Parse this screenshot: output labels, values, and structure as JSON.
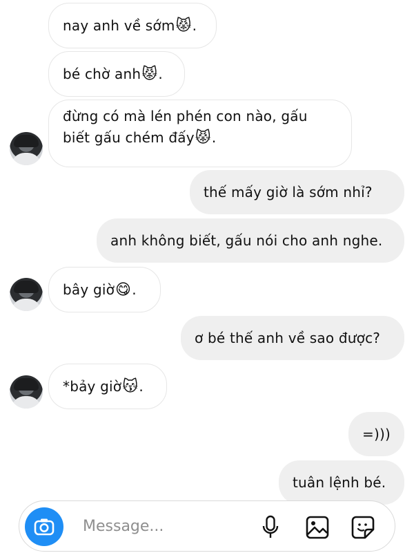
{
  "messages": [
    {
      "side": "in",
      "text": "nay anh về sớm",
      "emoji": "😾",
      "suffix": "."
    },
    {
      "side": "in",
      "text": "bé chờ anh",
      "emoji": "😾",
      "suffix": "."
    },
    {
      "side": "in",
      "lines": [
        "đừng có mà lén phén con nào, gấu",
        "biết gấu chém đấy"
      ],
      "emoji": "😾",
      "suffix": "."
    },
    {
      "side": "out",
      "text": "thế mấy giờ là sớm nhỉ?"
    },
    {
      "side": "out",
      "text": "anh không biết, gấu nói cho anh nghe."
    },
    {
      "side": "in",
      "text": "bây giờ",
      "emoji": "😋",
      "suffix": "."
    },
    {
      "side": "out",
      "text": "ơ bé thế anh về sao được?"
    },
    {
      "side": "in",
      "text": "*bảy giờ",
      "emoji": "😽",
      "suffix": "."
    },
    {
      "side": "out",
      "text": "=)))"
    },
    {
      "side": "out",
      "text": "tuân lệnh bé."
    }
  ],
  "composer": {
    "placeholder": "Message...",
    "icons": [
      "camera-icon",
      "microphone-icon",
      "gallery-icon",
      "sticker-icon"
    ],
    "camera_color": "#1f8ef5"
  }
}
